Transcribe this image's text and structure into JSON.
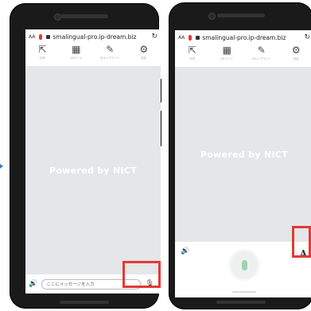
{
  "left_phone": {
    "url_bar": {
      "text_size_label": "AA",
      "domain": "smalingual-pro.ip-dream.biz",
      "reload_icon": "reload-icon"
    },
    "toolbar": [
      {
        "icon": "share-icon",
        "label": "共有"
      },
      {
        "icon": "qr-code-icon",
        "label": "QRコード"
      },
      {
        "icon": "edit-icon",
        "label": "ボキャブラリー"
      },
      {
        "icon": "gear-icon",
        "label": "設定"
      }
    ],
    "content": {
      "powered_by": "Powered by NICT"
    },
    "input_bar": {
      "placeholder": "ここにメッセージを入力",
      "speaker_icon": "speaker-icon",
      "mic_icon": "mic-icon"
    }
  },
  "right_phone": {
    "url_bar": {
      "text_size_label": "AA",
      "domain": "smalingual-pro.ip-dream.biz",
      "reload_icon": "reload-icon"
    },
    "toolbar": [
      {
        "icon": "share-icon",
        "label": "共有"
      },
      {
        "icon": "qr-code-icon",
        "label": "QRコード"
      },
      {
        "icon": "edit-icon",
        "label": "ボキャブラリー"
      },
      {
        "icon": "gear-icon",
        "label": "設定"
      }
    ],
    "content": {
      "powered_by": "Powered by NICT"
    },
    "voice_panel": {
      "speaker_icon": "speaker-icon",
      "font_label": "A",
      "mic_icon": "mic-icon"
    }
  },
  "highlight_color": "#e53935"
}
